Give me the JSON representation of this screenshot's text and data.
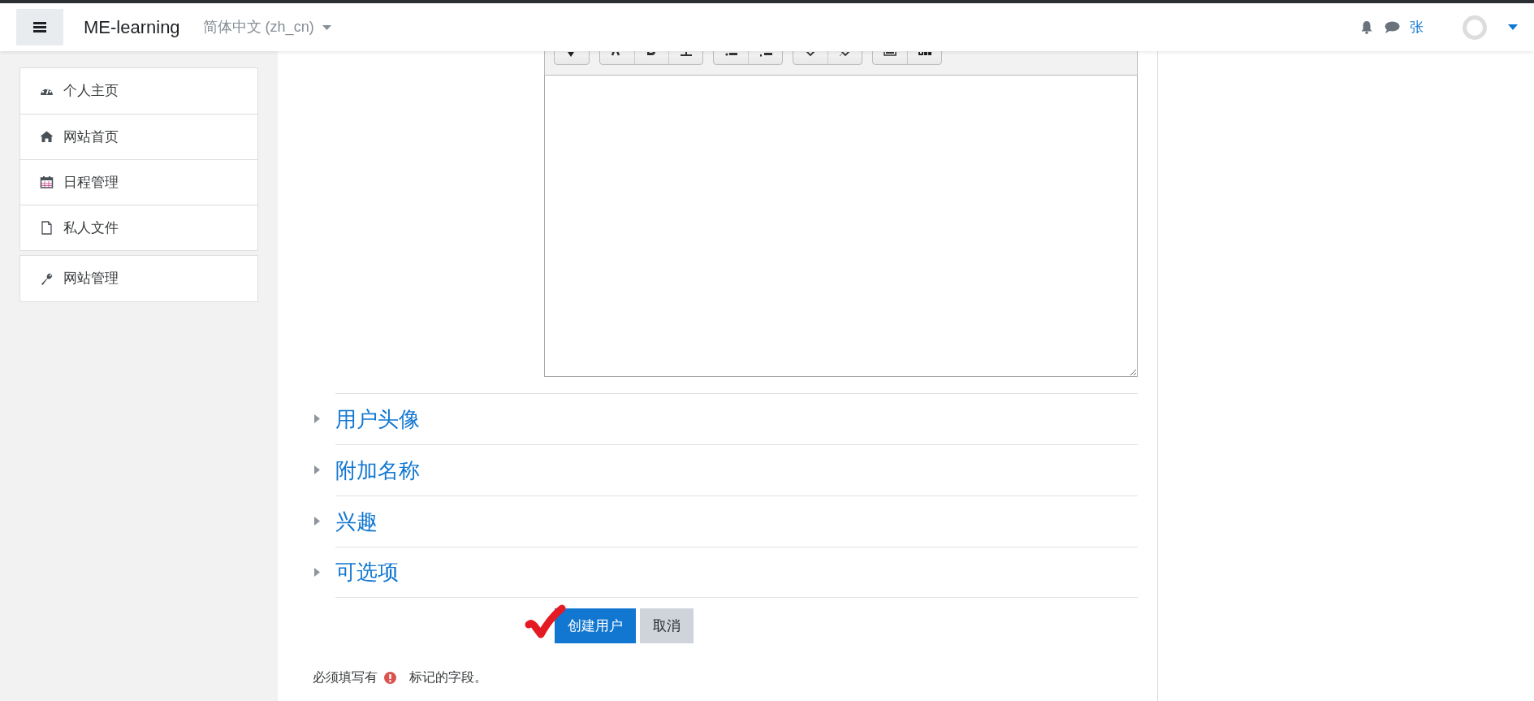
{
  "navbar": {
    "brand": "ME-learning",
    "language": "简体中文 (zh_cn)",
    "user_name": "张"
  },
  "sidebar": {
    "groups": [
      {
        "items": [
          {
            "label": "个人主页",
            "kind": "dashboard"
          },
          {
            "label": "网站首页",
            "kind": "home"
          },
          {
            "label": "日程管理",
            "kind": "calendar"
          },
          {
            "label": "私人文件",
            "kind": "file"
          }
        ]
      },
      {
        "items": [
          {
            "label": "网站管理",
            "kind": "wrench"
          }
        ]
      }
    ]
  },
  "sections": [
    {
      "label": "用户头像",
      "expanded": false
    },
    {
      "label": "附加名称",
      "expanded": false
    },
    {
      "label": "兴趣",
      "expanded": false
    },
    {
      "label": "可选项",
      "expanded": false
    }
  ],
  "buttons": [
    {
      "label": "创建用户",
      "kind": "primary"
    },
    {
      "label": "取消",
      "kind": "secondary"
    }
  ],
  "required_note": {
    "before": "必须填写有",
    "after": "标记的字段。"
  }
}
